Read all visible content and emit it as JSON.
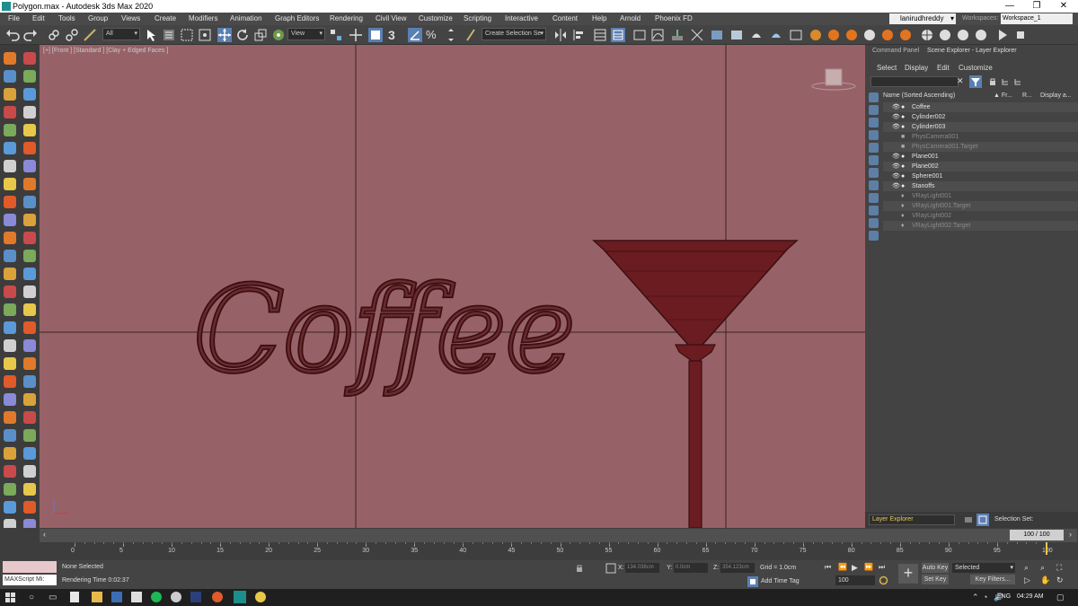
{
  "window": {
    "title": "Polygon.max - Autodesk 3ds Max 2020",
    "minimize": "—",
    "maximize": "❐",
    "close": "✕"
  },
  "menu": [
    "File",
    "Edit",
    "Tools",
    "Group",
    "Views",
    "Create",
    "Modifiers",
    "Animation",
    "Graph Editors",
    "Rendering",
    "Civil View",
    "Customize",
    "Scripting",
    "Interactive",
    "Content",
    "Help",
    "Arnold",
    "Phoenix FD"
  ],
  "account": {
    "user": "lanirudhreddy",
    "workspaces_label": "Workspaces:",
    "workspace": "Workspace_1"
  },
  "toolbar": {
    "filter": "All",
    "view": "View",
    "selection_set": "Create Selection Se",
    "snap_label": "3"
  },
  "viewport": {
    "label": "[+] [Front ] [Standard ] [Clay + Edged Faces ]",
    "text_object": "Coffee",
    "wire_color": "#3a0f12",
    "bg_color": "#976267"
  },
  "right_panel": {
    "tabs": [
      "Command Panel",
      "Scene Explorer - Layer Explorer"
    ],
    "menu": [
      "Select",
      "Display",
      "Edit",
      "Customize"
    ],
    "columns": {
      "name": "Name (Sorted Ascending)",
      "frozen": "▲ Fr...",
      "render": "R...",
      "display": "Display a..."
    },
    "rows": [
      {
        "name": "Coffee",
        "dim": false
      },
      {
        "name": "Cylinder002",
        "dim": false
      },
      {
        "name": "Cylinder003",
        "dim": false
      },
      {
        "name": "PhysCamera001",
        "dim": true
      },
      {
        "name": "PhysCamera001.Target",
        "dim": true
      },
      {
        "name": "Plane001",
        "dim": false
      },
      {
        "name": "Plane002",
        "dim": false
      },
      {
        "name": "Sphere001",
        "dim": false
      },
      {
        "name": "Stanoffs",
        "dim": false
      },
      {
        "name": "VRayLight001",
        "dim": true
      },
      {
        "name": "VRayLight001.Target",
        "dim": true
      },
      {
        "name": "VRayLight002",
        "dim": true
      },
      {
        "name": "VRayLight002.Target",
        "dim": true
      }
    ],
    "layer_explorer": "Layer Explorer",
    "selection_set_label": "Selection Set:"
  },
  "timeline": {
    "frame_display": "100 / 100",
    "ticks": [
      "0",
      "5",
      "10",
      "15",
      "20",
      "25",
      "30",
      "35",
      "40",
      "45",
      "50",
      "55",
      "60",
      "65",
      "70",
      "75",
      "80",
      "85",
      "90",
      "95",
      "100"
    ],
    "current": 100,
    "total": 100
  },
  "status": {
    "maxscript": "MAXScript Mi:",
    "selection": "None Selected",
    "rendering_time": "Rendering Time  0:02:37",
    "x_label": "X:",
    "x_value": "134.038cm",
    "y_label": "Y:",
    "y_value": "0.0cm",
    "z_label": "Z:",
    "z_value": "354.123cm",
    "grid": "Grid = 1.0cm",
    "add_time_tag": "Add Time Tag",
    "auto_key": "Auto Key",
    "set_key": "Set Key",
    "key_mode": "Selected",
    "key_filters": "Key Filters...",
    "frame": "100"
  },
  "taskbar": {
    "lang": "ENG",
    "time": "04:29 AM"
  }
}
